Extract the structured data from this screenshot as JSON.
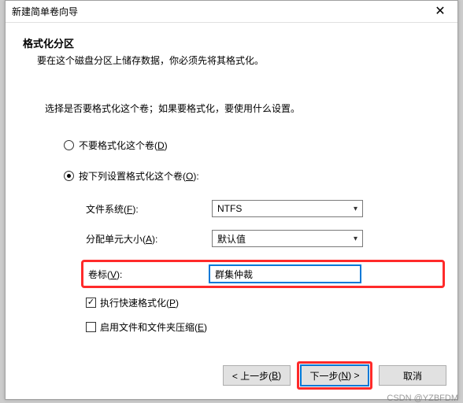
{
  "window": {
    "title": "新建简单卷向导",
    "close": "✕"
  },
  "section": {
    "title": "格式化分区",
    "desc": "要在这个磁盘分区上储存数据，你必须先将其格式化。"
  },
  "instruction": "选择是否要格式化这个卷；如果要格式化，要使用什么设置。",
  "radios": {
    "noformat_pre": "不要格式化这个卷(",
    "noformat_u": "D",
    "noformat_post": ")",
    "format_pre": "按下列设置格式化这个卷(",
    "format_u": "O",
    "format_post": "):"
  },
  "form": {
    "filesystem_pre": "文件系统(",
    "filesystem_u": "F",
    "filesystem_post": "):",
    "filesystem_value": "NTFS",
    "alloc_pre": "分配单元大小(",
    "alloc_u": "A",
    "alloc_post": "):",
    "alloc_value": "默认值",
    "label_pre": "卷标(",
    "label_u": "V",
    "label_post": "):",
    "label_value": "群集仲裁",
    "quick_pre": "执行快速格式化(",
    "quick_u": "P",
    "quick_post": ")",
    "compress_pre": "启用文件和文件夹压缩(",
    "compress_u": "E",
    "compress_post": ")"
  },
  "footer": {
    "back_pre": "< 上一步(",
    "back_u": "B",
    "back_post": ")",
    "next_pre": "下一步(",
    "next_u": "N",
    "next_post": ") >",
    "cancel": "取消"
  },
  "watermark": "CSDN @YZBFDM"
}
